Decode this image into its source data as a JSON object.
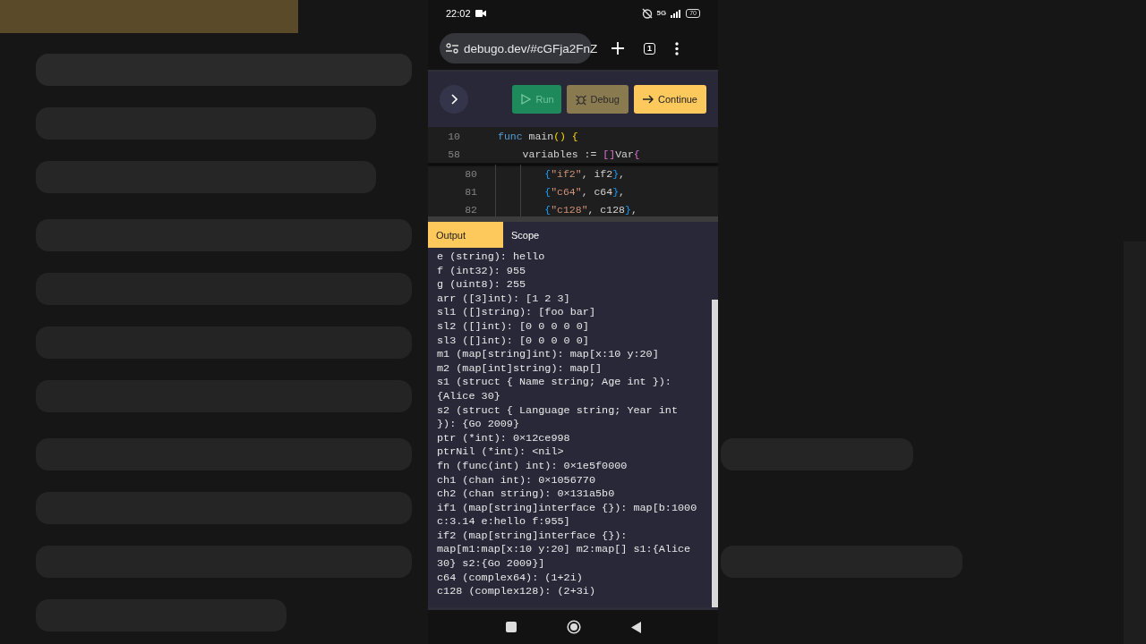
{
  "status_bar": {
    "time": "22:02",
    "battery": "70",
    "network": "5G"
  },
  "browser": {
    "url": "debugo.dev/#cGFja2FnZ",
    "tab_count": "1"
  },
  "toolbar": {
    "buttons": [
      {
        "label": "Run",
        "kind": "run",
        "disabled": true
      },
      {
        "label": "Debug",
        "kind": "debug",
        "disabled": true
      },
      {
        "label": "Continue",
        "kind": "continue",
        "disabled": false
      }
    ]
  },
  "editor": {
    "sticky_lines": [
      {
        "number": "10",
        "tokens": [
          {
            "text": "func",
            "kind": "keyword"
          },
          {
            "text": " main",
            "kind": "plain"
          },
          {
            "text": "() {",
            "kind": "bracket"
          }
        ]
      },
      {
        "number": "58",
        "tokens": [
          {
            "text": "    variables := ",
            "kind": "plain"
          },
          {
            "text": "[]",
            "kind": "bracket2"
          },
          {
            "text": "Var",
            "kind": "plain"
          },
          {
            "text": "{",
            "kind": "bracket2"
          }
        ]
      }
    ],
    "lines": [
      {
        "number": "80",
        "tokens": [
          {
            "text": "        {",
            "kind": "bracket3"
          },
          {
            "text": "\"if2\"",
            "kind": "string"
          },
          {
            "text": ", if2",
            "kind": "plain"
          },
          {
            "text": "}",
            "kind": "bracket3"
          },
          {
            "text": ",",
            "kind": "plain"
          }
        ]
      },
      {
        "number": "81",
        "tokens": [
          {
            "text": "        {",
            "kind": "bracket3"
          },
          {
            "text": "\"c64\"",
            "kind": "string"
          },
          {
            "text": ", c64",
            "kind": "plain"
          },
          {
            "text": "}",
            "kind": "bracket3"
          },
          {
            "text": ",",
            "kind": "plain"
          }
        ]
      },
      {
        "number": "82",
        "tokens": [
          {
            "text": "        {",
            "kind": "bracket3"
          },
          {
            "text": "\"c128\"",
            "kind": "string"
          },
          {
            "text": ", c128",
            "kind": "plain"
          },
          {
            "text": "}",
            "kind": "bracket3"
          },
          {
            "text": ",",
            "kind": "plain"
          }
        ]
      }
    ]
  },
  "tabs": [
    {
      "label": "Output",
      "selected": true
    },
    {
      "label": "Scope",
      "selected": false
    }
  ],
  "output": [
    "e (string): hello",
    "f (int32): 955",
    "g (uint8): 255",
    "arr ([3]int): [1 2 3]",
    "sl1 ([]string): [foo bar]",
    "sl2 ([]int): [0 0 0 0 0]",
    "sl3 ([]int): [0 0 0 0 0]",
    "m1 (map[string]int): map[x:10 y:20]",
    "m2 (map[int]string): map[]",
    "s1 (struct { Name string; Age int }):",
    "{Alice 30}",
    "s2 (struct { Language string; Year int",
    "}): {Go 2009}",
    "ptr (*int): 0×12ce998",
    "ptrNil (*int): <nil>",
    "fn (func(int) int): 0×1e5f0000",
    "ch1 (chan int): 0×1056770",
    "ch2 (chan string): 0×131a5b0",
    "if1 (map[string]interface {}): map[b:1000",
    "c:3.14 e:hello f:955]",
    "if2 (map[string]interface {}):",
    "map[m1:map[x:10 y:20] m2:map[] s1:{Alice",
    "30} s2:{Go 2009}]",
    "c64 (complex64): (1+2i)",
    "c128 (complex128): (2+3i)"
  ]
}
